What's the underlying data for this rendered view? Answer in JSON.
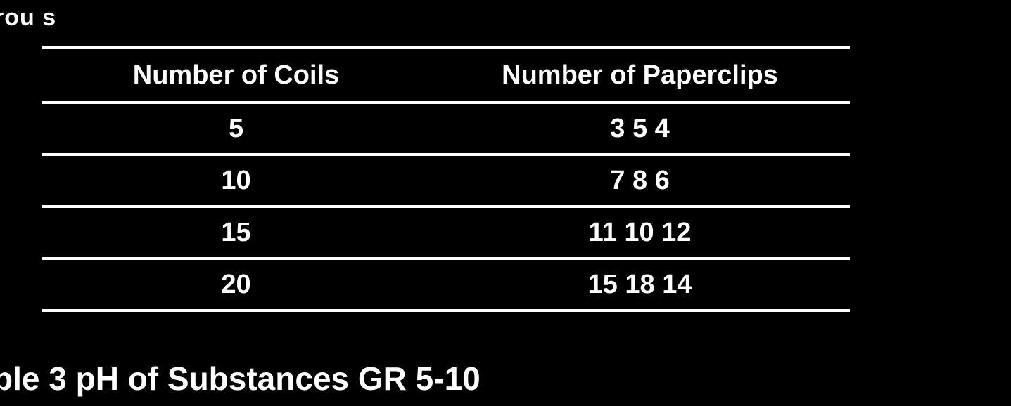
{
  "top_caption": "rou s",
  "table": {
    "headers": [
      "Number of Coils",
      "Number of Paperclips"
    ],
    "rows": [
      [
        "5",
        "3  5  4"
      ],
      [
        "10",
        "7  8  6"
      ],
      [
        "15",
        "11  10  12"
      ],
      [
        "20",
        "15  18  14"
      ]
    ]
  },
  "bottom_caption": "ble 3  pH of Substances  GR 5-10"
}
